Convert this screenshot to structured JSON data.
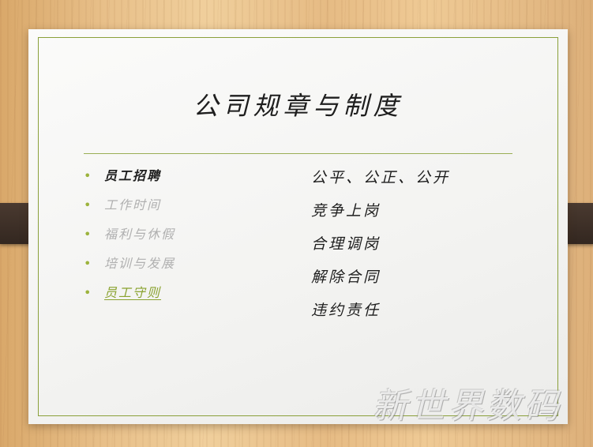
{
  "slide": {
    "title": "公司规章与制度",
    "bullets": [
      {
        "label": "员工招聘",
        "state": "active"
      },
      {
        "label": "工作时间",
        "state": "dim"
      },
      {
        "label": "福利与休假",
        "state": "dim"
      },
      {
        "label": "培训与发展",
        "state": "dim"
      },
      {
        "label": "员工守则",
        "state": "current"
      }
    ],
    "bullet_marker": "•",
    "details": [
      "公平、公正、公开",
      "竞争上岗",
      "合理调岗",
      "解除合同",
      "违约责任"
    ]
  },
  "watermark": "新世界数码",
  "colors": {
    "accent": "#9cb33c",
    "current": "#8aa330",
    "text": "#1e1e1e",
    "dim": "#b0b0b0"
  }
}
